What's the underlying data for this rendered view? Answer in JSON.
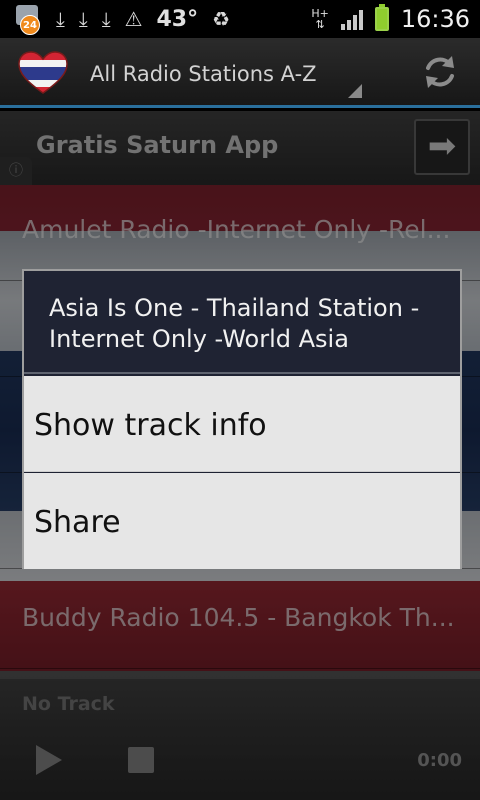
{
  "status_bar": {
    "notification_count": "24",
    "icons_left": [
      "download-icon",
      "download-icon",
      "download-icon",
      "warning-icon"
    ],
    "temperature": "43°",
    "recycle_icon": "recycle-icon",
    "network": "H+",
    "time": "16:36"
  },
  "action_bar": {
    "logo": "thai-flag-heart-icon",
    "spinner_label": "All Radio Stations A-Z",
    "refresh_icon": "refresh-icon"
  },
  "promo": {
    "label": "Gratis Saturn App",
    "arrow_icon": "arrow-right-icon",
    "info_glyph": "ⓘ"
  },
  "stations": [
    {
      "label": "Amulet Radio -Internet Only -Rel..."
    },
    {
      "label": "Buddy Radio 104.5 -  Bangkok Th..."
    }
  ],
  "player": {
    "track_label": "No Track",
    "time": "0:00"
  },
  "dialog": {
    "title": "Asia Is One - Thailand Station - Internet Only -World Asia",
    "items": [
      {
        "label": "Show track info"
      },
      {
        "label": "Share"
      }
    ]
  },
  "colors": {
    "accent": "#2a6f9c",
    "flag_red": "#8b2634",
    "flag_white": "#d9dde2",
    "flag_blue": "#1b2f57",
    "dialog_title_bg": "#1f2333",
    "dialog_item_bg": "#e6e6e6"
  }
}
